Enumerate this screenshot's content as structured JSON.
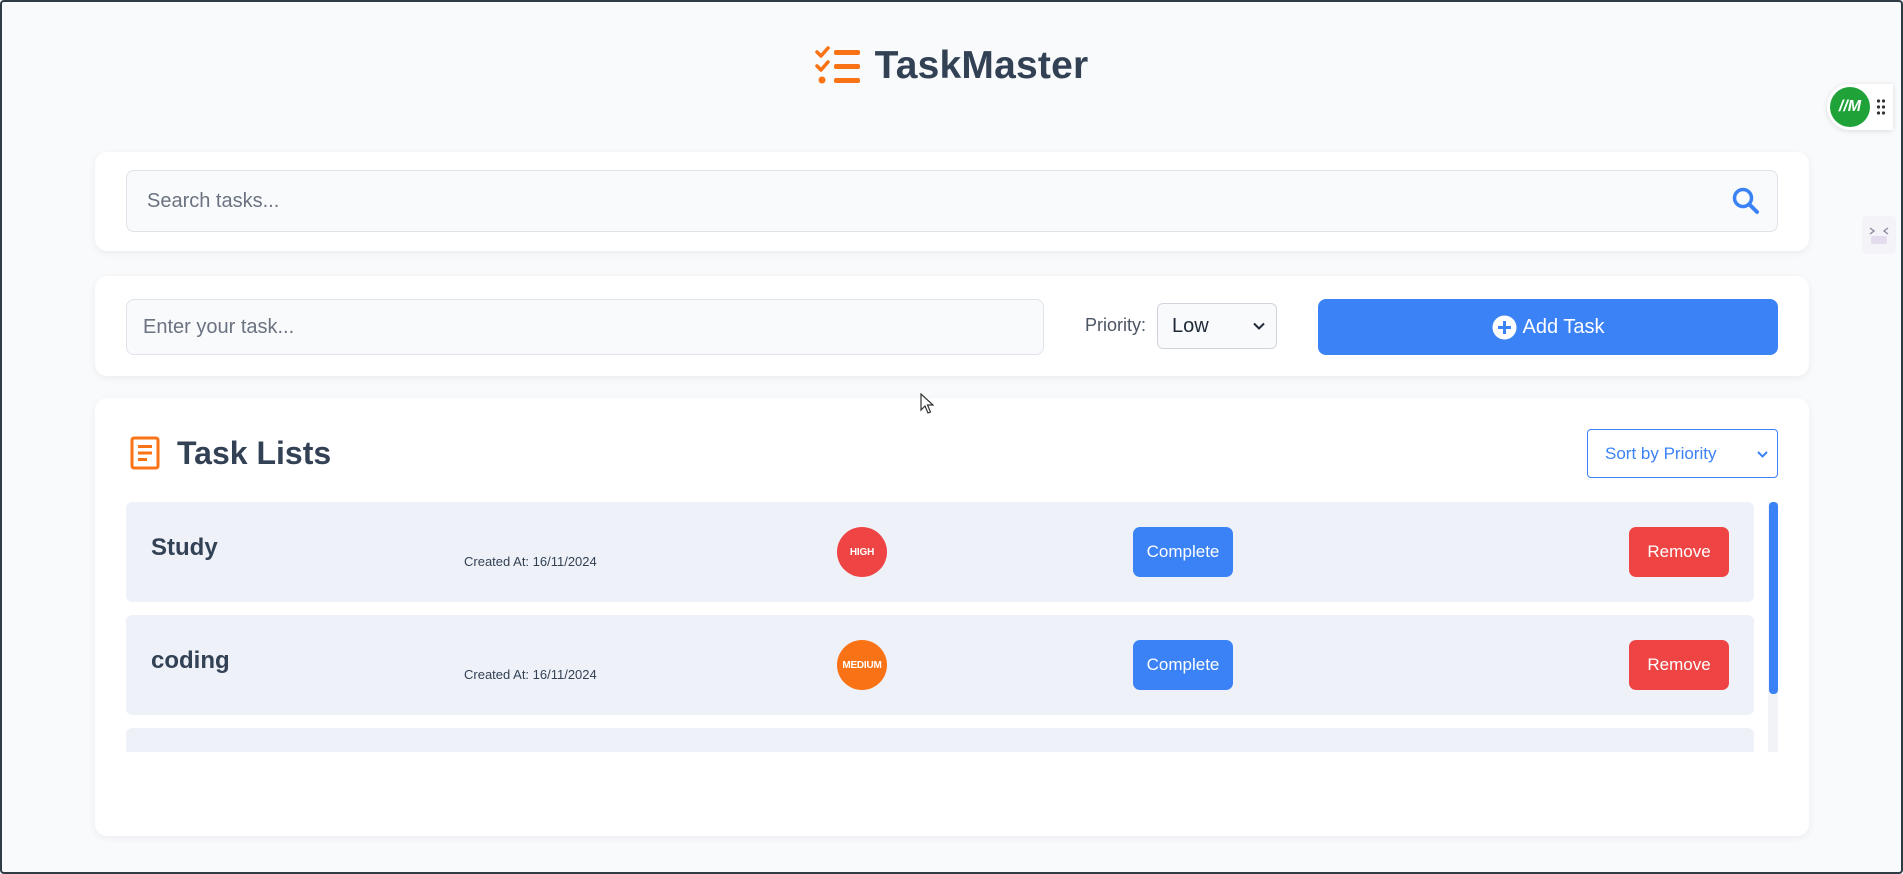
{
  "app": {
    "title": "TaskMaster"
  },
  "search": {
    "placeholder": "Search tasks..."
  },
  "add_task": {
    "input_placeholder": "Enter your task...",
    "priority_label": "Priority:",
    "priority_selected": "Low",
    "button_label": "Add Task"
  },
  "task_list": {
    "title": "Task Lists",
    "sort_selected": "Sort by Priority",
    "tasks": [
      {
        "name": "Study",
        "created": "Created At: 16/11/2024",
        "priority": "HIGH",
        "priority_color": "#ef4444",
        "complete_label": "Complete",
        "remove_label": "Remove"
      },
      {
        "name": "coding",
        "created": "Created At: 16/11/2024",
        "priority": "MEDIUM",
        "priority_color": "#f97316",
        "complete_label": "Complete",
        "remove_label": "Remove"
      }
    ]
  },
  "colors": {
    "accent": "#3b82f6",
    "danger": "#ef4444",
    "brand_icon": "#f97316"
  },
  "icons": [
    "checklist-logo-icon",
    "search-icon",
    "plus-circle-icon",
    "document-list-icon",
    "chevron-down-icon",
    "drag-handle-icon"
  ]
}
